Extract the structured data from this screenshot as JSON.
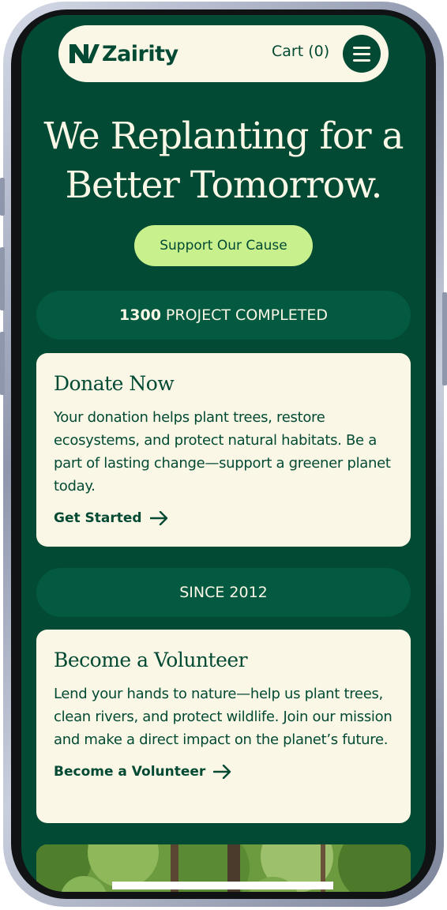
{
  "brand": {
    "name": "Zairity"
  },
  "header": {
    "cart_label": "Cart (0)"
  },
  "hero": {
    "title_line1": "We Replanting for a",
    "title_line2": "Better Tomorrow.",
    "cta_label": "Support Our Cause"
  },
  "stats": [
    {
      "value": "1300",
      "label": "PROJECT COMPLETED"
    },
    {
      "label": "SINCE 2012"
    }
  ],
  "cards": [
    {
      "title": "Donate Now",
      "text": "Your donation helps plant trees, restore ecosystems, and protect natural habitats. Be a part of lasting change—support a greener planet today.",
      "link": "Get Started"
    },
    {
      "title": "Become a Volunteer",
      "text": "Lend your hands to nature—help us plant trees, clean rivers, and protect wildlife. Join our mission and make a direct impact on the planet’s future.",
      "link": "Become a Volunteer"
    }
  ],
  "colors": {
    "background": "#024a33",
    "pill": "#035a40",
    "cream": "#fbf7e6",
    "accent": "#c8f08c"
  },
  "icons": [
    "logo-mark-icon",
    "menu-icon",
    "arrow-right-icon"
  ]
}
